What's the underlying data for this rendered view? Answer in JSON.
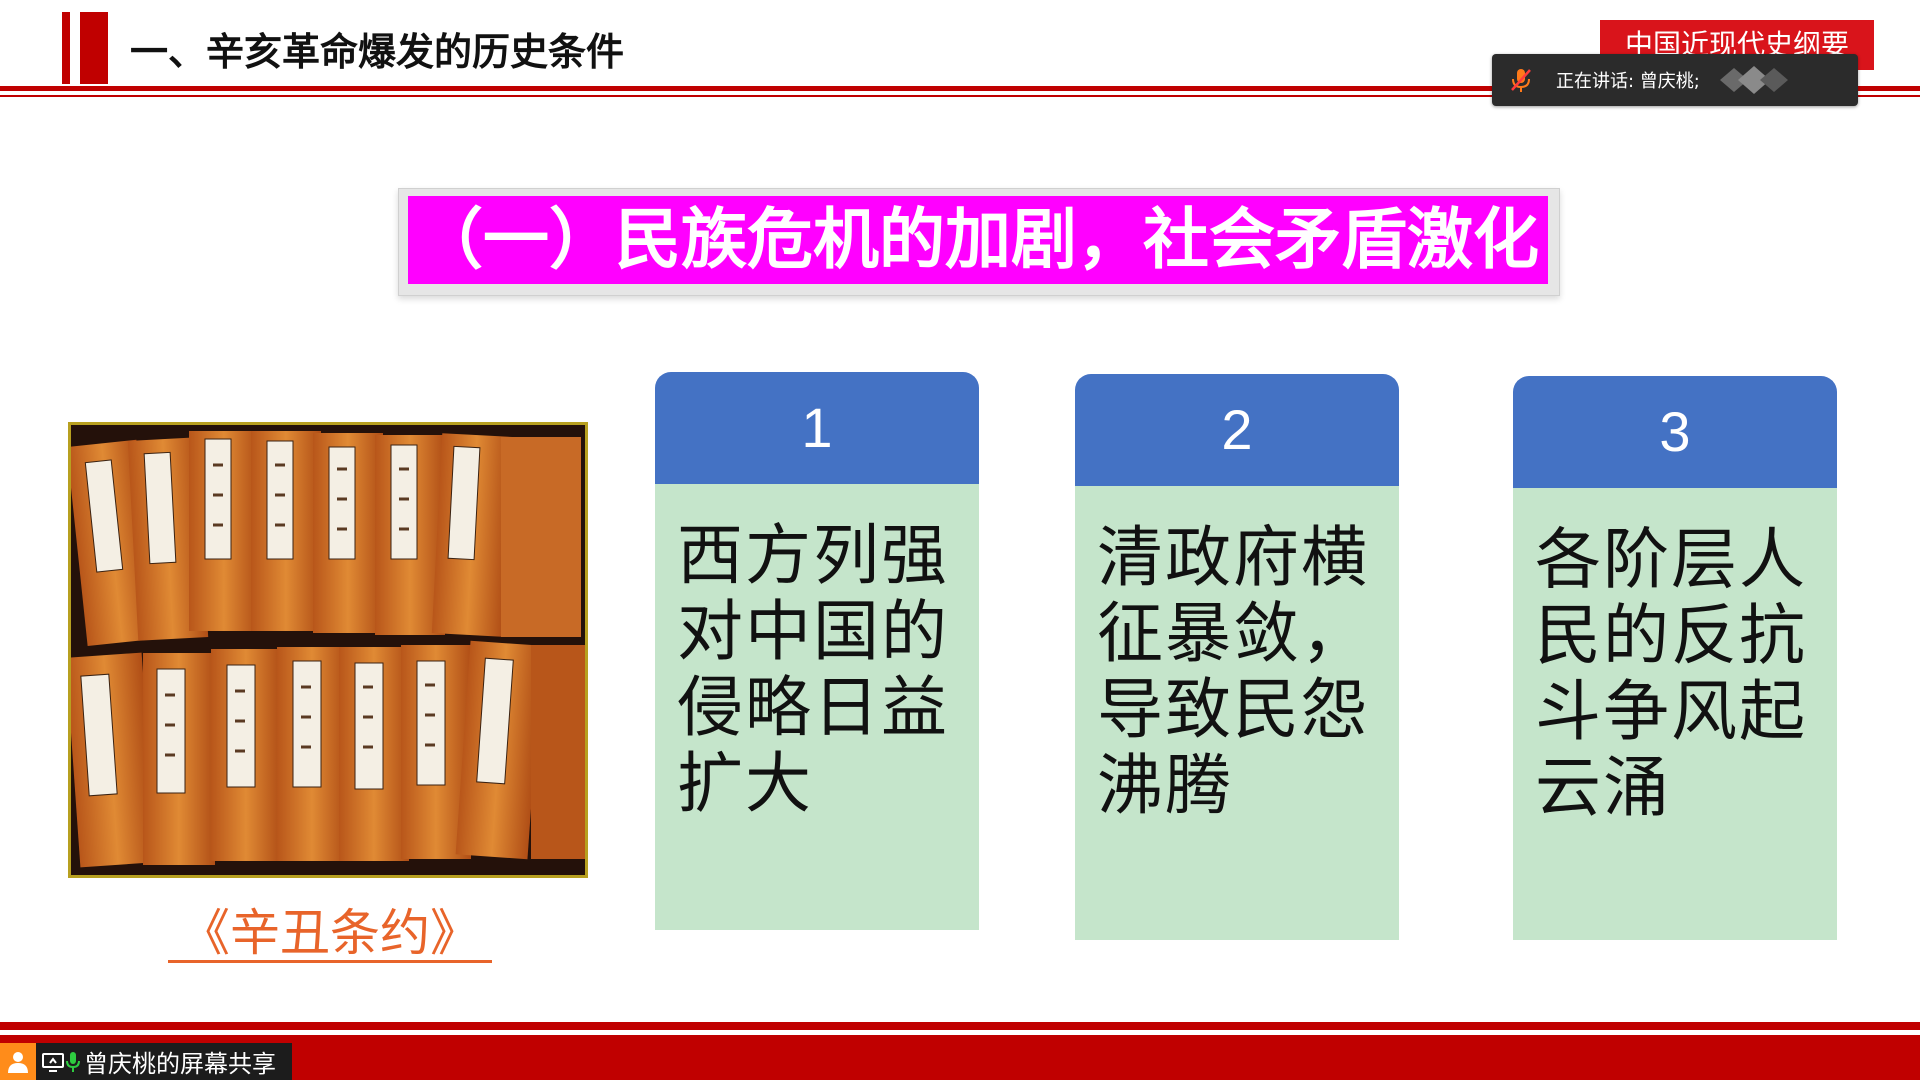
{
  "slide": {
    "header_title": "一、辛亥革命爆发的历史条件",
    "course_tag": "中国近现代史纲要",
    "section_banner": "（一）民族危机的加剧，社会矛盾激化",
    "photo_caption": "《辛丑条约》",
    "cards": [
      {
        "number": "1",
        "lines": [
          "西方列强",
          "对中国的",
          "侵略日益",
          "扩大"
        ]
      },
      {
        "number": "2",
        "lines": [
          "清政府横",
          "征暴敛，",
          "导致民怨",
          "沸腾"
        ]
      },
      {
        "number": "3",
        "lines": [
          "各阶层人",
          "民的反抗",
          "斗争风起",
          "云涌"
        ]
      }
    ]
  },
  "meeting": {
    "speaking_text": "正在讲话: 曾庆桃;",
    "share_label": "曾庆桃的屏幕共享"
  },
  "icons": {
    "speaking": "mic-muted-icon",
    "share": [
      "person-icon",
      "screen-share-icon",
      "mic-green-icon"
    ]
  },
  "colors": {
    "accent_red": "#c00000",
    "banner_magenta": "#ff00ff",
    "card_head_blue": "#4472c4",
    "card_body_green": "#c5e5cb",
    "caption_orange": "#e8642a"
  }
}
